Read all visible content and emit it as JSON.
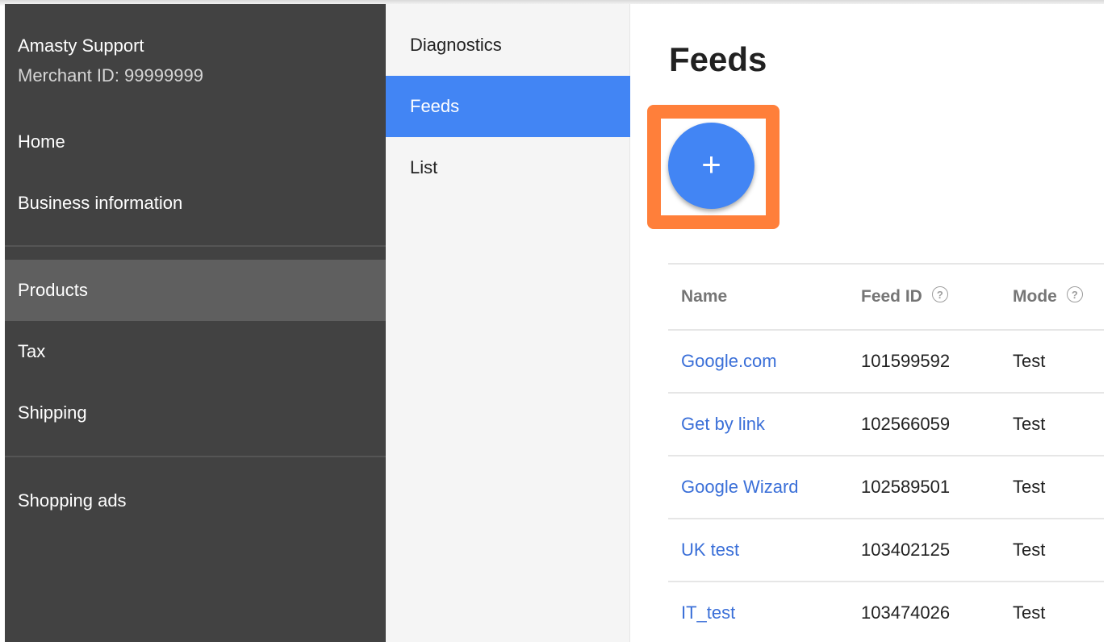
{
  "account": {
    "name": "Amasty Support",
    "merchant_id": "Merchant ID: 99999999"
  },
  "sidebar": {
    "items": [
      {
        "label": "Home"
      },
      {
        "label": "Business information"
      },
      {
        "label": "Products",
        "active": true
      },
      {
        "label": "Tax"
      },
      {
        "label": "Shipping"
      },
      {
        "label": "Shopping ads"
      }
    ]
  },
  "subnav": {
    "items": [
      {
        "label": "Diagnostics"
      },
      {
        "label": "Feeds",
        "active": true
      },
      {
        "label": "List"
      }
    ]
  },
  "main": {
    "title": "Feeds",
    "add_button_icon": "plus-icon",
    "add_button_glyph": "+",
    "highlight_color": "#ff7f3a"
  },
  "table": {
    "columns": [
      {
        "label": "Name"
      },
      {
        "label": "Feed ID",
        "help_icon": "?"
      },
      {
        "label": "Mode",
        "help_icon": "?"
      }
    ],
    "rows": [
      {
        "name": "Google.com",
        "feed_id": "101599592",
        "mode": "Test"
      },
      {
        "name": "Get by link",
        "feed_id": "102566059",
        "mode": "Test"
      },
      {
        "name": "Google Wizard",
        "feed_id": "102589501",
        "mode": "Test"
      },
      {
        "name": "UK test",
        "feed_id": "103402125",
        "mode": "Test"
      },
      {
        "name": "IT_test",
        "feed_id": "103474026",
        "mode": "Test"
      }
    ]
  },
  "colors": {
    "sidebar_bg": "#424242",
    "active_blue": "#4285f4",
    "link": "#3a6fd8"
  }
}
